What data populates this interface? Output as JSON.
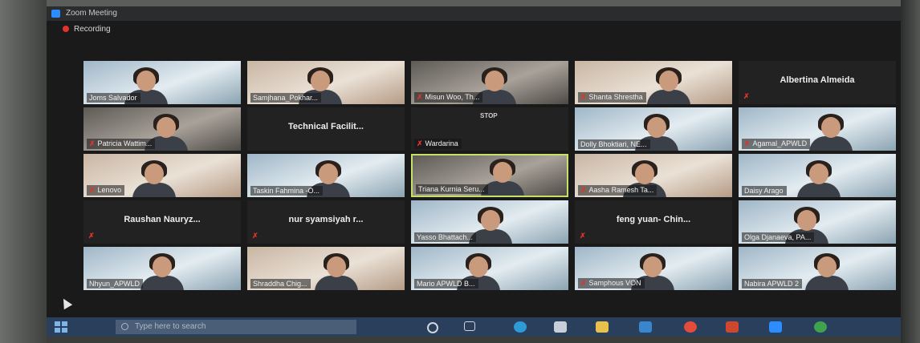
{
  "window": {
    "title": "Zoom Meeting",
    "recording_label": "Recording"
  },
  "taskbar": {
    "search_placeholder": "Type here to search"
  },
  "participants": [
    {
      "name": "Joms Salvador",
      "video": true,
      "muted": false,
      "tone": "cool"
    },
    {
      "name": "Samjhana_Pokhar...",
      "video": true,
      "muted": false,
      "tone": "warm"
    },
    {
      "name": "Misun Woo, Th...",
      "video": true,
      "muted": true,
      "tone": "dark"
    },
    {
      "name": "Shanta Shrestha",
      "video": true,
      "muted": true,
      "tone": "warm"
    },
    {
      "name": "Albertina Almeida",
      "video": false,
      "muted": true
    },
    {
      "name": "Patricia Wattim...",
      "video": true,
      "muted": true,
      "tone": "dark"
    },
    {
      "name": "Technical Facilit...",
      "video": false,
      "muted": false
    },
    {
      "name": "Wardarina",
      "video": false,
      "muted": true,
      "sign": "STOP"
    },
    {
      "name": "Dolly Bhoktiari, NE...",
      "video": true,
      "muted": false,
      "tone": "cool"
    },
    {
      "name": "Agamal_APWLD",
      "video": true,
      "muted": true,
      "tone": "cool"
    },
    {
      "name": "Lenovo",
      "video": true,
      "muted": true,
      "tone": "warm"
    },
    {
      "name": "Taskin Fahmina -O...",
      "video": true,
      "muted": false,
      "tone": "cool"
    },
    {
      "name": "Triana Kurnia Seru...",
      "video": true,
      "muted": false,
      "tone": "dark",
      "active": true
    },
    {
      "name": "Aasha Ramesh Ta...",
      "video": true,
      "muted": true,
      "tone": "warm"
    },
    {
      "name": "Daisy Arago",
      "video": true,
      "muted": false,
      "tone": "cool"
    },
    {
      "name": "Raushan Nauryz...",
      "video": false,
      "muted": true
    },
    {
      "name": "nur syamsiyah r...",
      "video": false,
      "muted": true
    },
    {
      "name": "Yasso Bhattach...",
      "video": true,
      "muted": false,
      "tone": "cool"
    },
    {
      "name": "feng yuan- Chin...",
      "video": false,
      "muted": true
    },
    {
      "name": "Olga Djanaeva, PA...",
      "video": true,
      "muted": false,
      "tone": "cool"
    },
    {
      "name": "Nhyun_APWLD",
      "video": true,
      "muted": false,
      "tone": "cool"
    },
    {
      "name": "Shraddha Chig...",
      "video": true,
      "muted": false,
      "tone": "warm"
    },
    {
      "name": "Mario APWLD B...",
      "video": true,
      "muted": false,
      "tone": "cool"
    },
    {
      "name": "Samphous VON",
      "video": true,
      "muted": true,
      "tone": "cool"
    },
    {
      "name": "Nabira APWLD 2",
      "video": true,
      "muted": false,
      "tone": "cool"
    }
  ],
  "colors": {
    "muted_icon": "#e0342c",
    "active_speaker_border": "#c7e06a",
    "taskbar": "#2a3f5b"
  }
}
